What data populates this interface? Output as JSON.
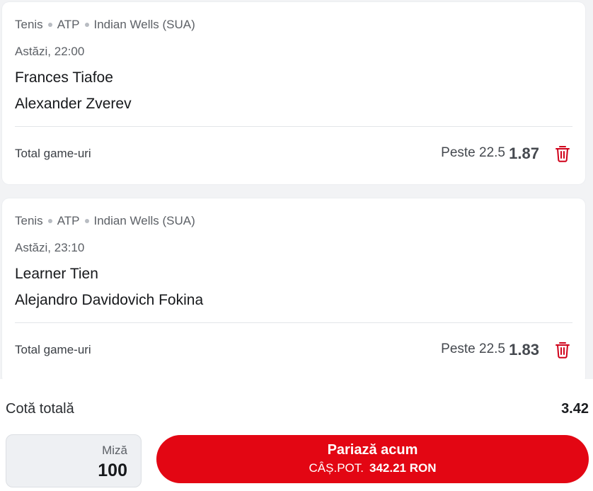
{
  "selections": [
    {
      "sport": "Tenis",
      "category": "ATP",
      "tournament": "Indian Wells (SUA)",
      "time": "Astăzi, 22:00",
      "team1": "Frances Tiafoe",
      "team2": "Alexander Zverev",
      "market": "Total game-uri",
      "pick": "Peste 22.5",
      "odd": "1.87"
    },
    {
      "sport": "Tenis",
      "category": "ATP",
      "tournament": "Indian Wells (SUA)",
      "time": "Astăzi, 23:10",
      "team1": "Learner Tien",
      "team2": "Alejandro Davidovich Fokina",
      "market": "Total game-uri",
      "pick": "Peste 22.5",
      "odd": "1.83"
    }
  ],
  "footer": {
    "total_label": "Cotă totală",
    "total_value": "3.42",
    "stake_label": "Miză",
    "stake_value": "100",
    "bet_button_label": "Pariază acum",
    "potential_label": "CÂȘ.POT.",
    "potential_value": "342.21 RON"
  },
  "colors": {
    "accent": "#e30613",
    "delete_icon": "#d0021b"
  },
  "icons": {
    "delete": "trash-icon"
  }
}
